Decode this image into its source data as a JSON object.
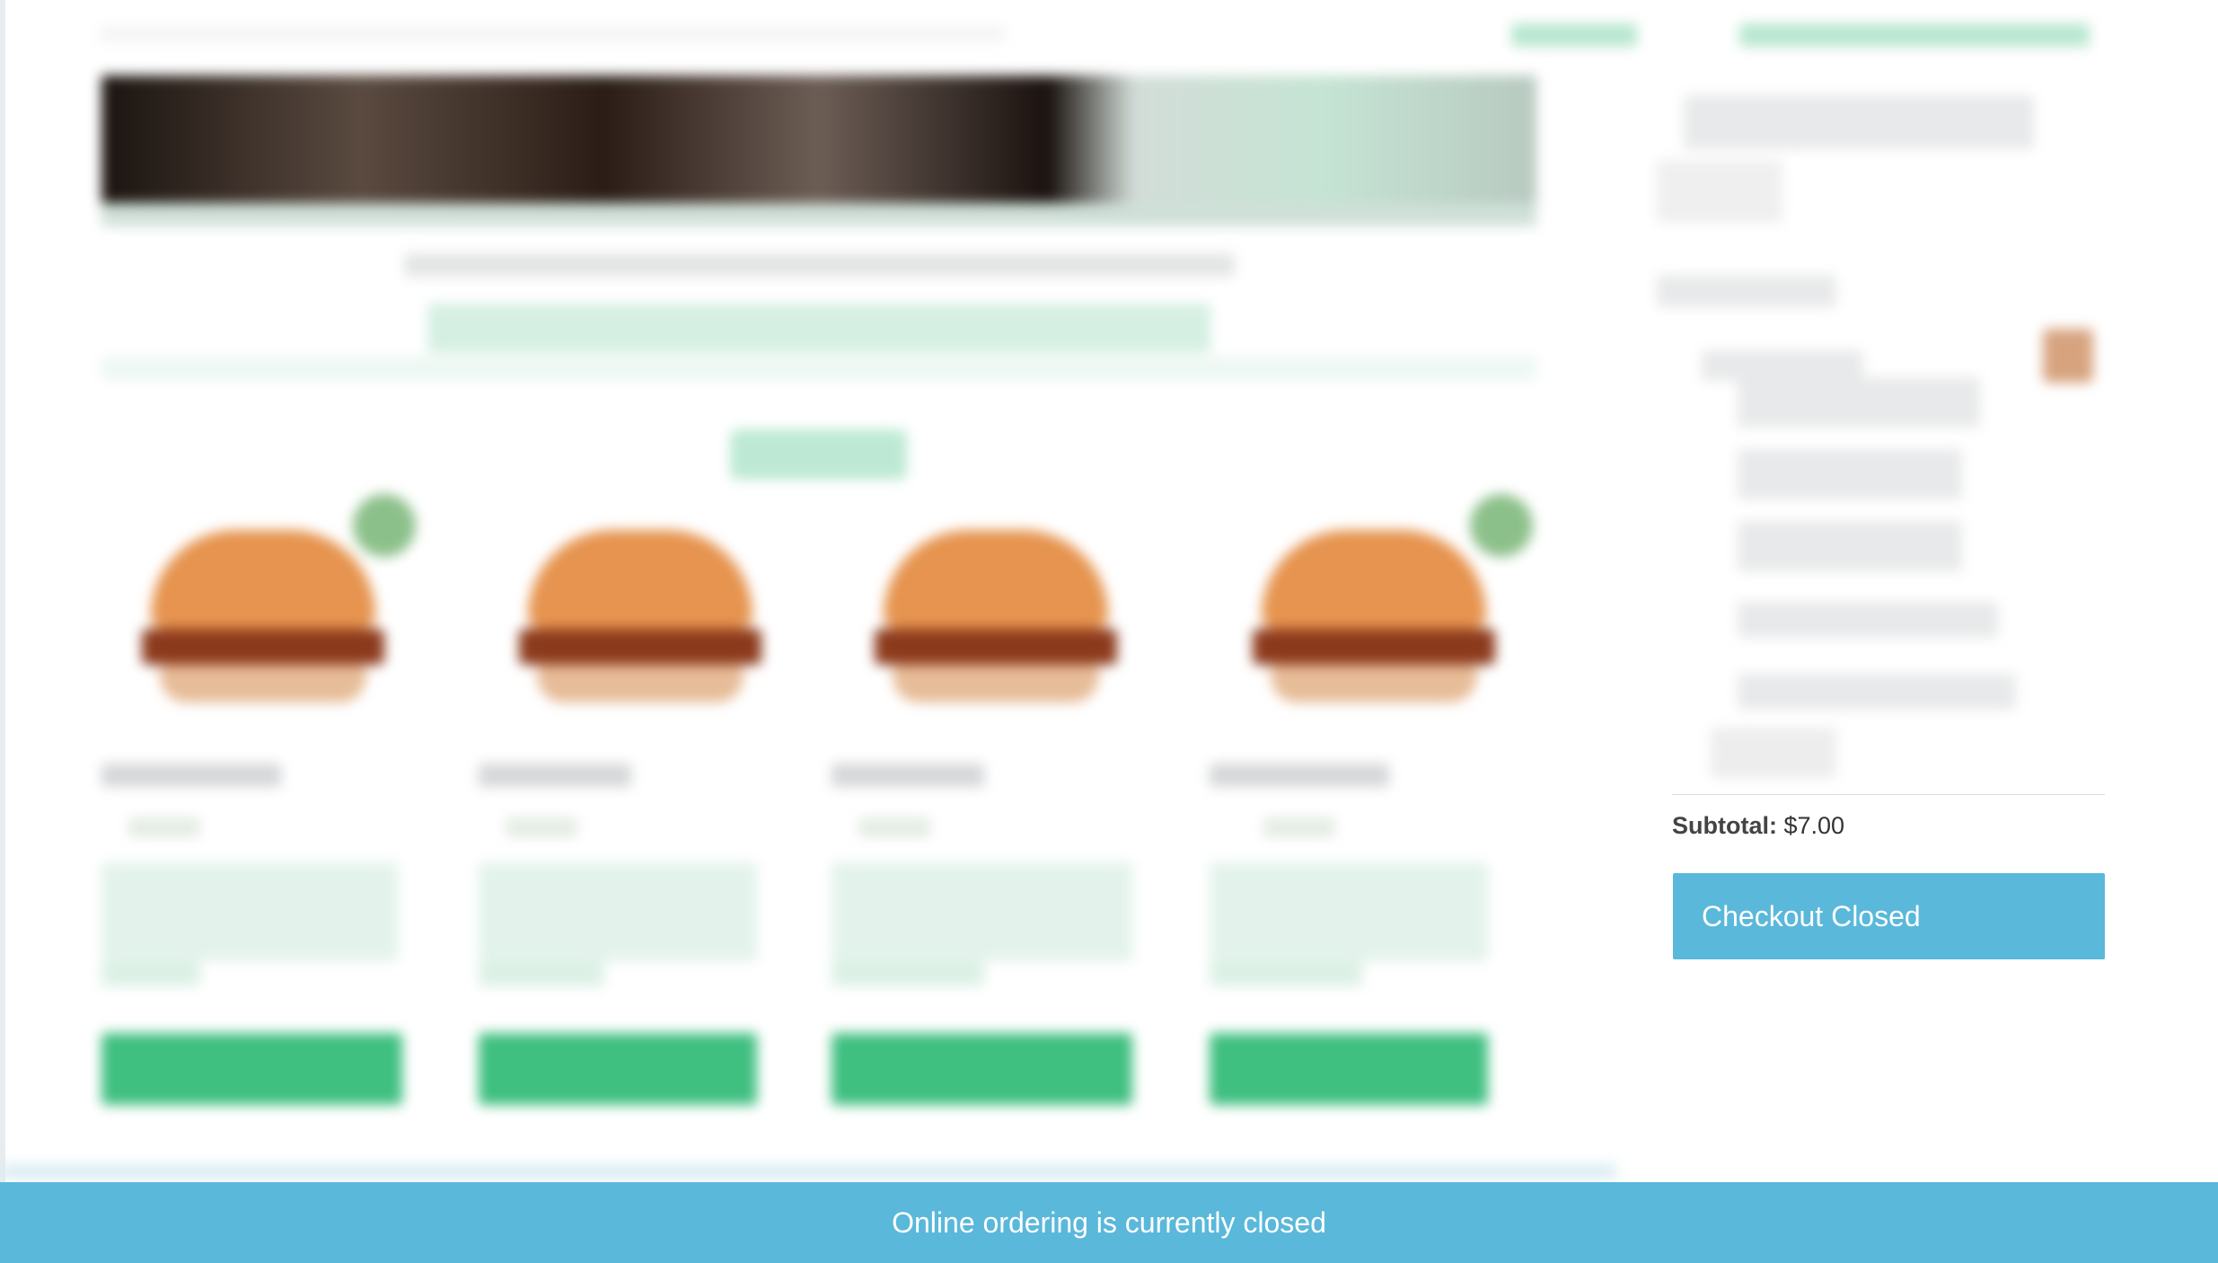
{
  "cart": {
    "subtotal_label": "Subtotal:",
    "subtotal_value": "$7.00",
    "checkout_button": "Checkout Closed"
  },
  "notice": {
    "text": "Online ordering is currently closed"
  },
  "colors": {
    "accent_blue": "#5ab8da",
    "accent_green": "#3fbf80"
  },
  "icons": [
    "burger-image",
    "leaf-badge-icon"
  ]
}
